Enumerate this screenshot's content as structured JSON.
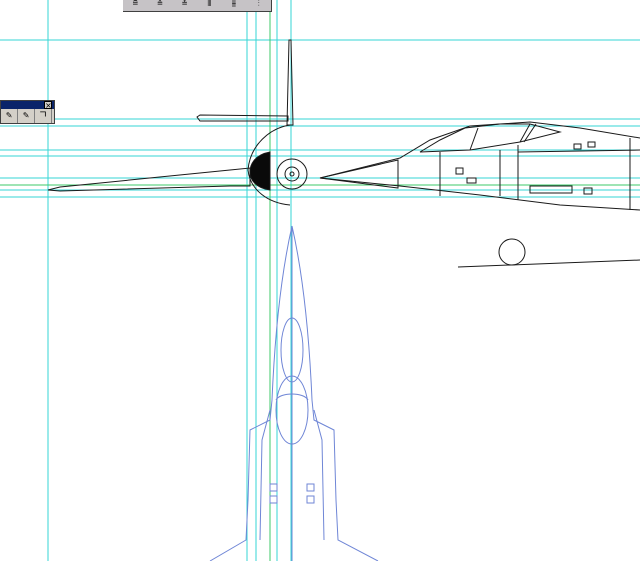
{
  "toolbar": {
    "buttons": [
      {
        "name": "align-left-icon",
        "glyph": "≘"
      },
      {
        "name": "align-center-icon",
        "glyph": "≙"
      },
      {
        "name": "align-right-icon",
        "glyph": "≚"
      },
      {
        "name": "align-top-icon",
        "glyph": "⫴"
      },
      {
        "name": "align-middle-icon",
        "glyph": "⫵"
      },
      {
        "name": "align-bottom-icon",
        "glyph": "⫶"
      }
    ]
  },
  "palette": {
    "close_glyph": "×",
    "tools": [
      {
        "name": "pen-tool-icon",
        "glyph": "✎"
      },
      {
        "name": "add-anchor-icon",
        "glyph": "✎"
      },
      {
        "name": "convert-anchor-icon",
        "glyph": "ㄱ"
      }
    ]
  },
  "colors": {
    "guide_cyan": "#36d6d6",
    "guide_green": "#3cc96a",
    "outline_black": "#1a1a1a",
    "outline_blue": "#6f86d6"
  }
}
